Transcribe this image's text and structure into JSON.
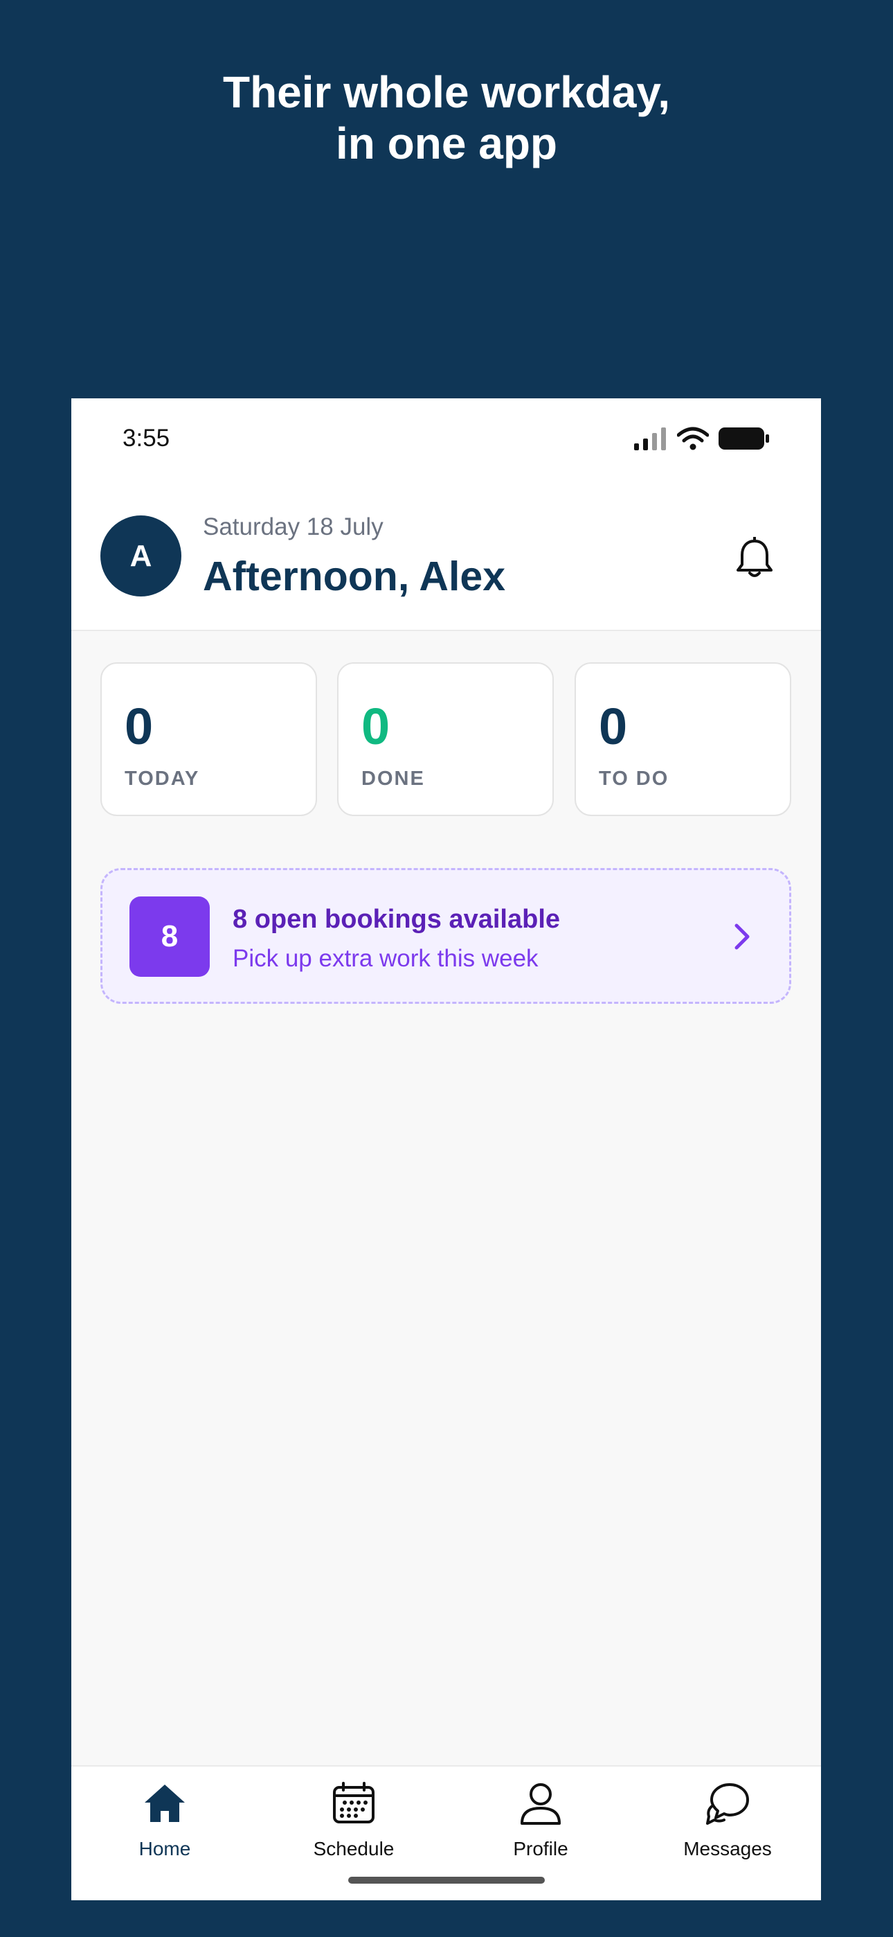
{
  "marketing": {
    "headline_line1": "Their whole workday,",
    "headline_line2": "in one app"
  },
  "status_bar": {
    "time": "3:55",
    "icons": [
      "signal-icon",
      "wifi-icon",
      "battery-icon"
    ]
  },
  "header": {
    "avatar_initial": "A",
    "date": "Saturday 18 July",
    "greeting": "Afternoon, Alex",
    "notification_icon": "bell-icon"
  },
  "stats": [
    {
      "value": "0",
      "label": "TODAY"
    },
    {
      "value": "0",
      "label": "DONE"
    },
    {
      "value": "0",
      "label": "TO DO"
    }
  ],
  "bookings_banner": {
    "count": "8",
    "title": "8 open bookings available",
    "subtitle": "Pick up extra work this week"
  },
  "tab_bar": {
    "active": "Home",
    "tabs": [
      {
        "label": "Home",
        "icon": "home-icon"
      },
      {
        "label": "Schedule",
        "icon": "calendar-icon"
      },
      {
        "label": "Profile",
        "icon": "person-icon"
      },
      {
        "label": "Messages",
        "icon": "chat-icon"
      }
    ]
  },
  "colors": {
    "background": "#0f3656",
    "brand_navy": "#0f3656",
    "done_green": "#10b981",
    "accent_purple": "#7c3aed",
    "banner_bg": "#f4f1ff"
  }
}
